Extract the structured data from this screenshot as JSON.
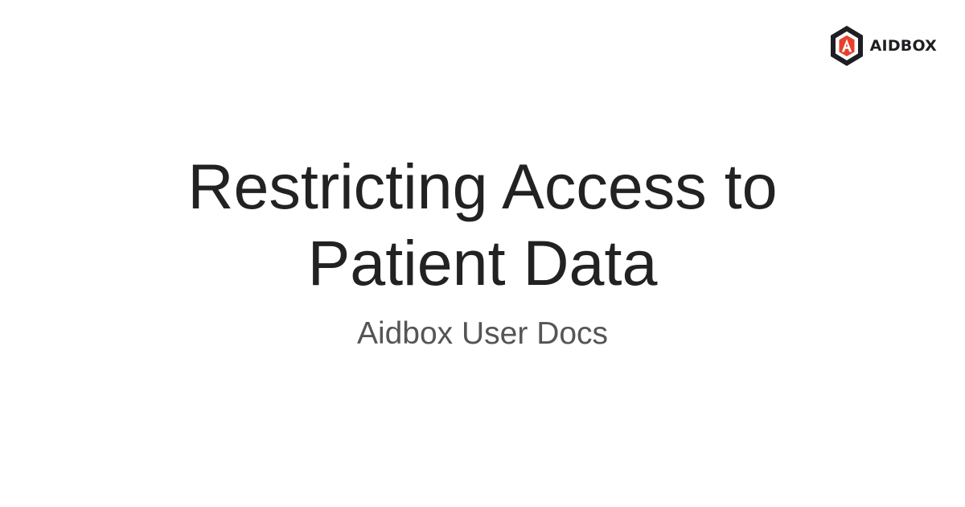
{
  "brand": {
    "name": "AIDBOX",
    "icon": "aidbox-hexagon-logo-icon",
    "colors": {
      "outline": "#1d1f23",
      "accent": "#e8402b"
    }
  },
  "page": {
    "title_line_1": "Restricting Access to",
    "title_line_2": "Patient Data",
    "subtitle": "Aidbox User Docs"
  }
}
